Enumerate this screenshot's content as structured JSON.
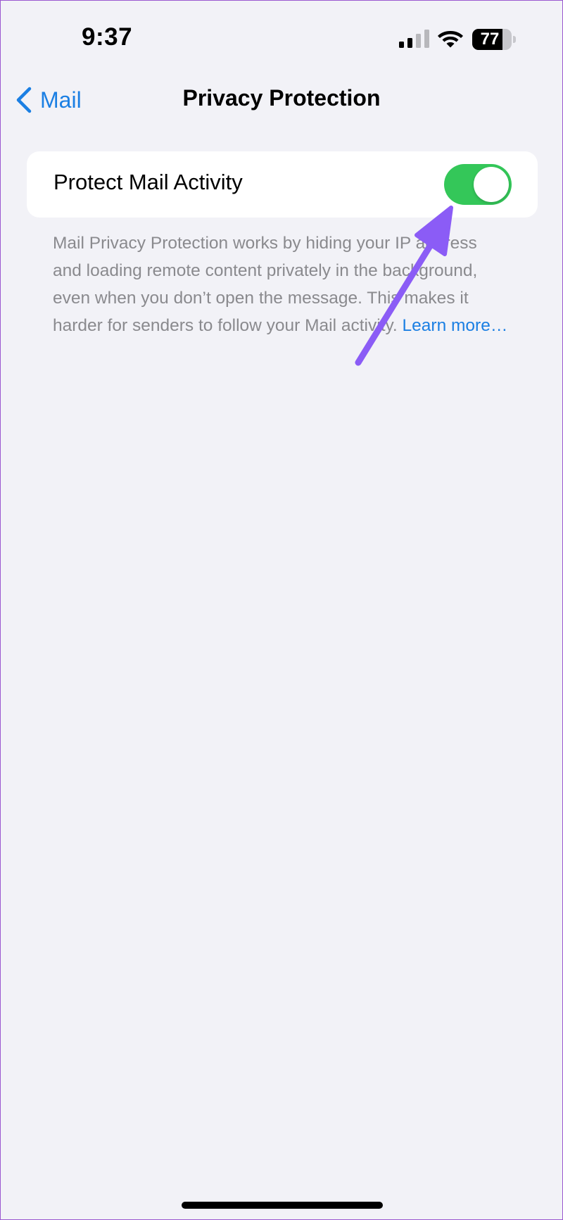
{
  "status_bar": {
    "time": "9:37",
    "battery_level": "77",
    "battery_fraction": 0.77,
    "signal_icon": "cellular-signal-icon",
    "wifi_icon": "wifi-icon"
  },
  "nav": {
    "back_label": "Mail",
    "back_icon": "chevron-left-icon",
    "title": "Privacy Protection"
  },
  "setting": {
    "label": "Protect Mail Activity",
    "toggle_on": true
  },
  "footer": {
    "description": "Mail Privacy Protection works by hiding your IP address and loading remote content privately in the background, even when you don’t open the message. This makes it harder for senders to follow your Mail activity. ",
    "learn_more": "Learn more…"
  },
  "colors": {
    "accent": "#1B7FE3",
    "toggle_on": "#34C759",
    "background": "#F2F2F7",
    "annotation_arrow": "#8B5CF6"
  }
}
